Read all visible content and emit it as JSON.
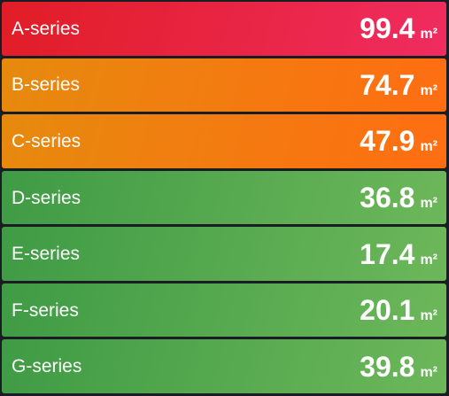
{
  "panel": {
    "rows": [
      {
        "label": "A-series",
        "value": "99.4",
        "unit": "m²",
        "status": "critical",
        "color_start": "#e11d26",
        "color_end": "#f02c60"
      },
      {
        "label": "B-series",
        "value": "74.7",
        "unit": "m²",
        "status": "warning",
        "color_start": "#e68a0e",
        "color_end": "#ff6d12"
      },
      {
        "label": "C-series",
        "value": "47.9",
        "unit": "m²",
        "status": "warning",
        "color_start": "#e68a0e",
        "color_end": "#ff6d12"
      },
      {
        "label": "D-series",
        "value": "36.8",
        "unit": "m²",
        "status": "ok",
        "color_start": "#3f9b45",
        "color_end": "#6db75a"
      },
      {
        "label": "E-series",
        "value": "17.4",
        "unit": "m²",
        "status": "ok",
        "color_start": "#3f9b45",
        "color_end": "#6db75a"
      },
      {
        "label": "F-series",
        "value": "20.1",
        "unit": "m²",
        "status": "ok",
        "color_start": "#3f9b45",
        "color_end": "#6db75a"
      },
      {
        "label": "G-series",
        "value": "39.8",
        "unit": "m²",
        "status": "ok",
        "color_start": "#3f9b45",
        "color_end": "#6db75a"
      }
    ]
  }
}
